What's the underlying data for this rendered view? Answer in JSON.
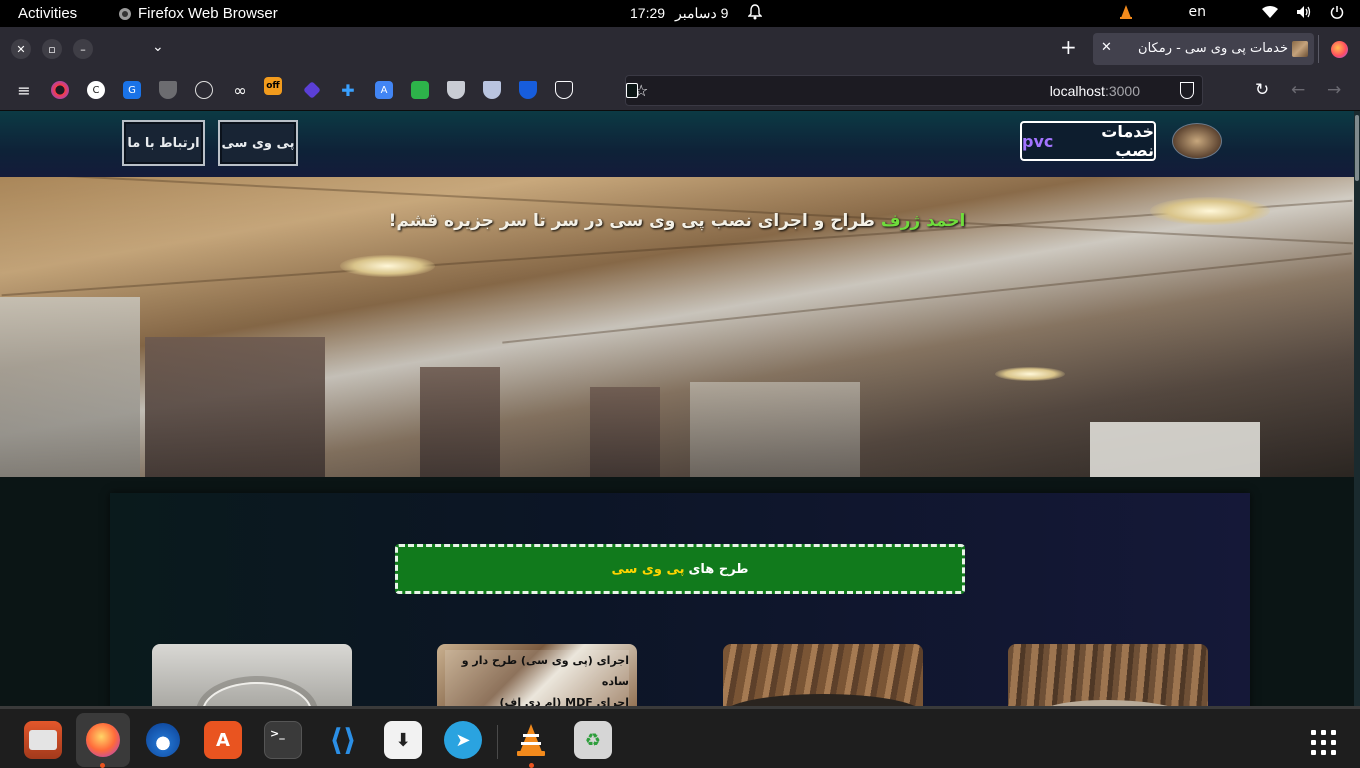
{
  "system_bar": {
    "activities": "Activities",
    "app_name": "Firefox Web Browser",
    "time": "17:29",
    "date": "9 دسامبر",
    "language": "en"
  },
  "browser": {
    "tab_title": "خدمات پی وی سی - رمکان",
    "url_host": "localhost",
    "url_port": ":3000",
    "toolbar_icons": [
      "menu-icon",
      "opera-icon",
      "ext-c-icon",
      "ext-ub-icon",
      "shield-ext-icon",
      "globe-icon",
      "infinity-icon",
      "off-badge-icon",
      "diamond-icon",
      "plus-cross-icon",
      "translate-icon",
      "green-ext-icon",
      "shield2-icon",
      "shield3-icon",
      "bitwarden-icon",
      "pocket-icon"
    ]
  },
  "site": {
    "brand_text": "خدمات نصب",
    "brand_pvc": "pvc",
    "nav": {
      "pvc": "پی وی سی",
      "contact": "ارتباط با ما"
    },
    "hero": {
      "name": "احمد ژرف",
      "tagline": "طراح و اجرای نصب پی وی سی در سر تا سر جزیره قشم!"
    },
    "section": {
      "title_pre": "طرح های",
      "title_hl": "پی وی سی"
    },
    "card2_text_line1": "اجرای (پی وی سی) طرح دار و ساده",
    "card2_text_line2": "اجرای MDF (ام دی اف)"
  },
  "dock": {
    "apps": [
      "files",
      "firefox",
      "thunderbird",
      "app-center",
      "terminal",
      "vscode",
      "downloader",
      "telegram",
      "vlc",
      "trash"
    ]
  },
  "colors": {
    "accent_green": "#117a1c",
    "name_green": "#6fdc3c",
    "highlight_yellow": "#ffd400",
    "brand_purple": "#a374ff",
    "ubuntu_orange": "#e95420"
  }
}
